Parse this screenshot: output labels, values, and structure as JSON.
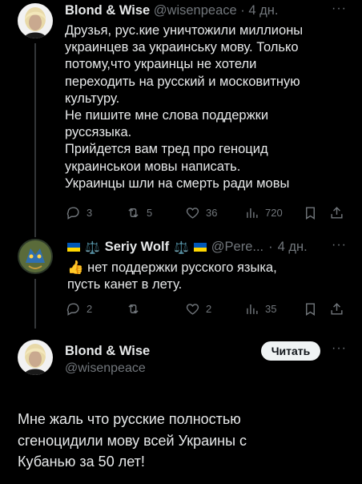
{
  "tweet1": {
    "name": "Blond & Wise",
    "handle": "@wisenpeace",
    "sep": "·",
    "time": "4 дн.",
    "lines": [
      "Друзья, рус.кие уничтожили миллионы",
      "украинцев за украинську мову. Только",
      "потому,что украинцы не хотели",
      "переходить на русский и московитную",
      "культуру.",
      "Не пишите мне слова поддержки",
      "руссязыка.",
      "Прийдется вам тред про геноцид",
      "украинськои мовы написать.",
      "Украинцы шли на смерть ради мовы"
    ],
    "replies": "3",
    "reposts": "5",
    "likes": "36",
    "views": "720"
  },
  "tweet2": {
    "scales_left": "⚖️",
    "name": "Seriy Wolf",
    "scales_right": "⚖️",
    "handle": "@Pere...",
    "sep": "·",
    "time": "4 дн.",
    "thumbs": "👍",
    "line1": "нет поддержки русского языка,",
    "line2": "пусть канет в лету.",
    "replies": "2",
    "reposts": "",
    "likes": "2",
    "views": "35"
  },
  "tweet3": {
    "name": "Blond & Wise",
    "handle": "@wisenpeace",
    "follow_label": "Читать",
    "lines": [
      "Мне жаль что русские полностью",
      "сгеноцидили мову всей Украины с",
      "Кубанью за 50 лет!"
    ]
  },
  "colors": {
    "background": "#000000",
    "text": "#e7e9ea",
    "muted": "#71767b",
    "divider": "#333639",
    "flag_blue": "#0057b7",
    "flag_yellow": "#ffd700"
  },
  "icons": [
    "reply-icon",
    "repost-icon",
    "like-icon",
    "views-icon",
    "bookmark-icon",
    "share-icon",
    "more-icon"
  ]
}
